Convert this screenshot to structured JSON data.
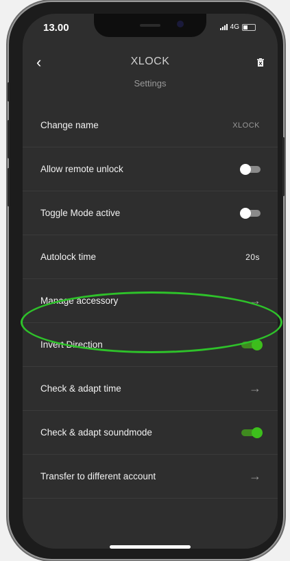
{
  "status_bar": {
    "time": "13.00",
    "network": "4G"
  },
  "header": {
    "title": "XLOCK",
    "subtitle": "Settings",
    "back_icon": "chevron-left-icon",
    "delete_icon": "trash-icon"
  },
  "rows": [
    {
      "label": "Change name",
      "value": "XLOCK"
    },
    {
      "label": "Allow remote unlock",
      "toggle": "off"
    },
    {
      "label": "Toggle Mode active",
      "toggle": "off"
    },
    {
      "label": "Autolock time",
      "value": "20s"
    },
    {
      "label": "Manage accessory",
      "arrow": "→"
    },
    {
      "label": "Invert Direction",
      "toggle": "on"
    },
    {
      "label": "Check & adapt time",
      "arrow": "→"
    },
    {
      "label": "Check & adapt soundmode",
      "toggle": "on"
    },
    {
      "label": "Transfer to different account",
      "arrow": "→"
    }
  ],
  "colors": {
    "toggle_on": "#3dbe1c",
    "highlight_ellipse": "#2ec22a",
    "screen_bg": "#2e2e2e"
  }
}
